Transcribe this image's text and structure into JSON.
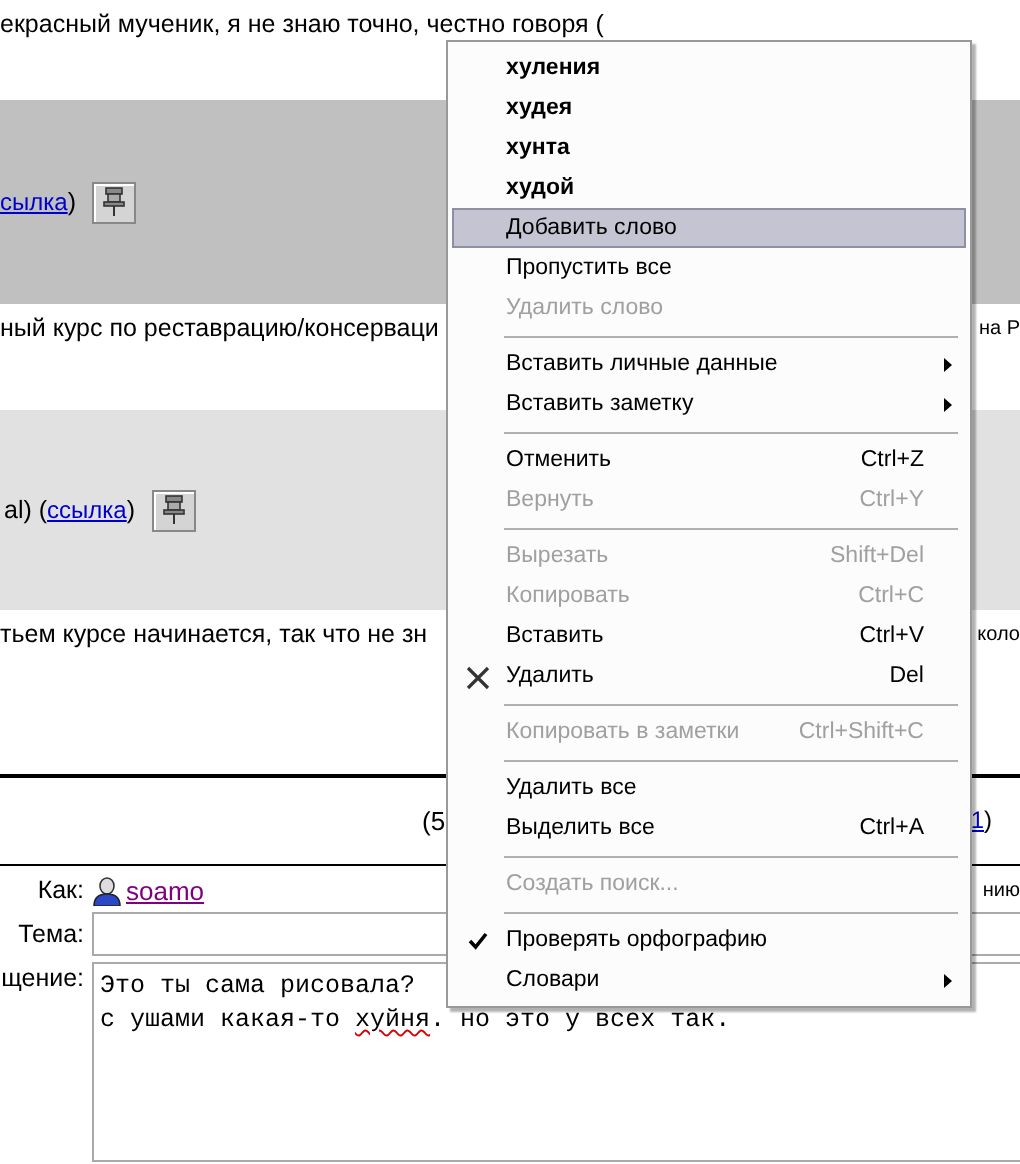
{
  "comments": [
    {
      "kind": "text",
      "text": "екрасный мученик, я не знаю точно, честно говоря ("
    },
    {
      "kind": "band",
      "color": "#c0c0c0",
      "link": "сылка",
      "after": ")"
    },
    {
      "kind": "text",
      "text": "ный курс по реставрацию/консерваци",
      "text_right": "на Р"
    },
    {
      "kind": "band",
      "color": "#e1e1e1",
      "before": "al) (",
      "link": "ссылка",
      "after": ")"
    },
    {
      "kind": "text",
      "text": "тьем курсе начинается, так что не зн",
      "text_right": "коло"
    }
  ],
  "pager": {
    "left": "(5",
    "link": "1",
    "right": ")"
  },
  "form": {
    "author_label": "Как:",
    "author": "soamo",
    "author_right": "нию",
    "subject_label": "Тема:",
    "message_label": "щение:",
    "message_lines": [
      [
        {
          "text": "Это ты сама рисовала?",
          "misspelled": false
        }
      ],
      [
        {
          "text": "с ушами какая-то ",
          "misspelled": false
        },
        {
          "text": "хуйня",
          "misspelled": true
        },
        {
          "text": ". но это у всех так.",
          "misspelled": false
        }
      ]
    ]
  },
  "context_menu": [
    {
      "kind": "suggestion",
      "label": "хуления",
      "selected": false
    },
    {
      "kind": "suggestion",
      "label": "худея",
      "selected": false
    },
    {
      "kind": "suggestion",
      "label": "хунта",
      "selected": false
    },
    {
      "kind": "suggestion",
      "label": "худой",
      "selected": false
    },
    {
      "kind": "command",
      "label": "Добавить слово",
      "selected": true,
      "disabled": false
    },
    {
      "kind": "command",
      "label": "Пропустить все",
      "selected": false,
      "disabled": false
    },
    {
      "kind": "command",
      "label": "Удалить слово",
      "selected": false,
      "disabled": true
    },
    {
      "kind": "separator"
    },
    {
      "kind": "command",
      "label": "Вставить личные данные",
      "selected": false,
      "disabled": false,
      "submenu": true
    },
    {
      "kind": "command",
      "label": "Вставить заметку",
      "selected": false,
      "disabled": false,
      "submenu": true
    },
    {
      "kind": "separator"
    },
    {
      "kind": "command",
      "label": "Отменить",
      "shortcut": "Ctrl+Z",
      "selected": false,
      "disabled": false
    },
    {
      "kind": "command",
      "label": "Вернуть",
      "shortcut": "Ctrl+Y",
      "selected": false,
      "disabled": true
    },
    {
      "kind": "separator"
    },
    {
      "kind": "command",
      "label": "Вырезать",
      "shortcut": "Shift+Del",
      "selected": false,
      "disabled": true
    },
    {
      "kind": "command",
      "label": "Копировать",
      "shortcut": "Ctrl+C",
      "selected": false,
      "disabled": true
    },
    {
      "kind": "command",
      "label": "Вставить",
      "shortcut": "Ctrl+V",
      "selected": false,
      "disabled": false
    },
    {
      "kind": "delete",
      "label": "Удалить",
      "shortcut": "Del",
      "selected": false,
      "disabled": false
    },
    {
      "kind": "separator"
    },
    {
      "kind": "command",
      "label": "Копировать в заметки",
      "shortcut": "Ctrl+Shift+C",
      "selected": false,
      "disabled": true
    },
    {
      "kind": "separator"
    },
    {
      "kind": "command",
      "label": "Удалить все",
      "selected": false,
      "disabled": false
    },
    {
      "kind": "command",
      "label": "Выделить все",
      "shortcut": "Ctrl+A",
      "selected": false,
      "disabled": false
    },
    {
      "kind": "separator"
    },
    {
      "kind": "command",
      "label": "Создать поиск...",
      "selected": false,
      "disabled": true
    },
    {
      "kind": "separator"
    },
    {
      "kind": "command",
      "label": "Проверять орфографию",
      "selected": false,
      "disabled": false,
      "checked": true
    },
    {
      "kind": "command",
      "label": "Словари",
      "selected": false,
      "disabled": false,
      "submenu": true
    }
  ]
}
